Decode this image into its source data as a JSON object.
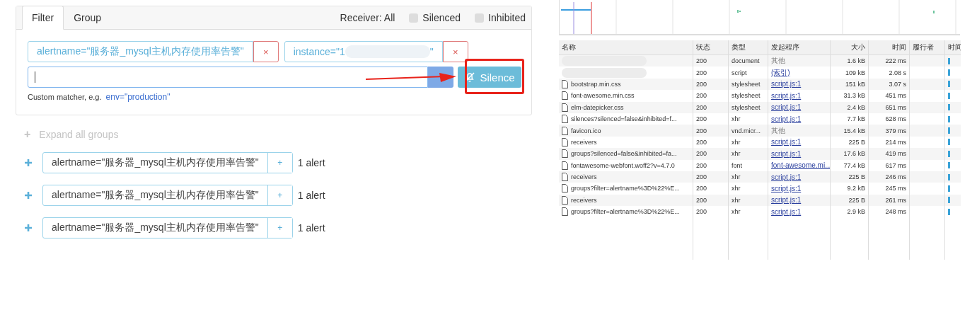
{
  "filter_panel": {
    "tabs": [
      {
        "label": "Filter",
        "selected": true
      },
      {
        "label": "Group",
        "selected": false
      }
    ],
    "receiver": "Receiver: All",
    "checkboxes": [
      {
        "label": "Silenced",
        "checked": false
      },
      {
        "label": "Inhibited",
        "checked": false
      }
    ],
    "matchers": [
      {
        "text_start": "alertname=\"服务器_mysql主机内存使用率告警\"",
        "blurred": false,
        "remove": "×"
      },
      {
        "text_start": "instance=\"1",
        "blurred": true,
        "text_end": "\"",
        "remove": "×"
      }
    ],
    "silence_button": "Silence",
    "hint": "Custom matcher, e.g.",
    "hint_example": "env=\"production\""
  },
  "expand_all": {
    "icon": "+",
    "label": "Expand all groups",
    "disabled": true
  },
  "groups": [
    {
      "label": "alertname=\"服务器_mysql主机内存使用率告警\"",
      "add": "+",
      "count": "1 alert"
    },
    {
      "label": "alertname=\"服务器_mysql主机内存使用率告警\"",
      "add": "+",
      "count": "1 alert"
    },
    {
      "label": "alertname=\"服务器_mysql主机内存使用率告警\"",
      "add": "+",
      "count": "1 alert"
    }
  ],
  "network": {
    "columns": [
      "名称",
      "状态",
      "类型",
      "发起程序",
      "大小",
      "时间",
      "履行者",
      "时间"
    ],
    "rows": [
      {
        "blurred": true,
        "status": "200",
        "type": "document",
        "initiator": "其他",
        "initiator_link": false,
        "size": "1.6 kB",
        "time": "222 ms"
      },
      {
        "blurred": true,
        "status": "200",
        "type": "script",
        "initiator": "(索引)",
        "initiator_link": true,
        "size": "109 kB",
        "time": "2.08 s"
      },
      {
        "blurred": false,
        "name": "bootstrap.min.css",
        "status": "200",
        "type": "stylesheet",
        "initiator": "script.js:1",
        "initiator_link": true,
        "size": "151 kB",
        "time": "3.07 s"
      },
      {
        "blurred": false,
        "name": "font-awesome.min.css",
        "status": "200",
        "type": "stylesheet",
        "initiator": "script.js:1",
        "initiator_link": true,
        "size": "31.3 kB",
        "time": "451 ms"
      },
      {
        "blurred": false,
        "name": "elm-datepicker.css",
        "status": "200",
        "type": "stylesheet",
        "initiator": "script.js:1",
        "initiator_link": true,
        "size": "2.4 kB",
        "time": "651 ms"
      },
      {
        "blurred": false,
        "name": "silences?silenced=false&inhibited=f...",
        "status": "200",
        "type": "xhr",
        "initiator": "script.js:1",
        "initiator_link": true,
        "size": "7.7 kB",
        "time": "628 ms"
      },
      {
        "blurred": false,
        "name": "favicon.ico",
        "status": "200",
        "type": "vnd.micr...",
        "initiator": "其他",
        "initiator_link": false,
        "size": "15.4 kB",
        "time": "379 ms"
      },
      {
        "blurred": false,
        "name": "receivers",
        "status": "200",
        "type": "xhr",
        "initiator": "script.js:1",
        "initiator_link": true,
        "size": "225 B",
        "time": "214 ms"
      },
      {
        "blurred": false,
        "name": "groups?silenced=false&inhibited=fa...",
        "status": "200",
        "type": "xhr",
        "initiator": "script.js:1",
        "initiator_link": true,
        "size": "17.6 kB",
        "time": "419 ms"
      },
      {
        "blurred": false,
        "name": "fontawesome-webfont.woff2?v=4.7.0",
        "status": "200",
        "type": "font",
        "initiator": "font-awesome.mi...",
        "initiator_link": true,
        "size": "77.4 kB",
        "time": "617 ms"
      },
      {
        "blurred": false,
        "name": "receivers",
        "status": "200",
        "type": "xhr",
        "initiator": "script.js:1",
        "initiator_link": true,
        "size": "225 B",
        "time": "246 ms"
      },
      {
        "blurred": false,
        "name": "groups?filter=alertname%3D%22%E...",
        "status": "200",
        "type": "xhr",
        "initiator": "script.js:1",
        "initiator_link": true,
        "size": "9.2 kB",
        "time": "245 ms"
      },
      {
        "blurred": false,
        "name": "receivers",
        "status": "200",
        "type": "xhr",
        "initiator": "script.js:1",
        "initiator_link": true,
        "size": "225 B",
        "time": "261 ms"
      },
      {
        "blurred": false,
        "name": "groups?filter=alertname%3D%22%E...",
        "status": "200",
        "type": "xhr",
        "initiator": "script.js:1",
        "initiator_link": true,
        "size": "2.9 kB",
        "time": "248 ms"
      }
    ]
  }
}
